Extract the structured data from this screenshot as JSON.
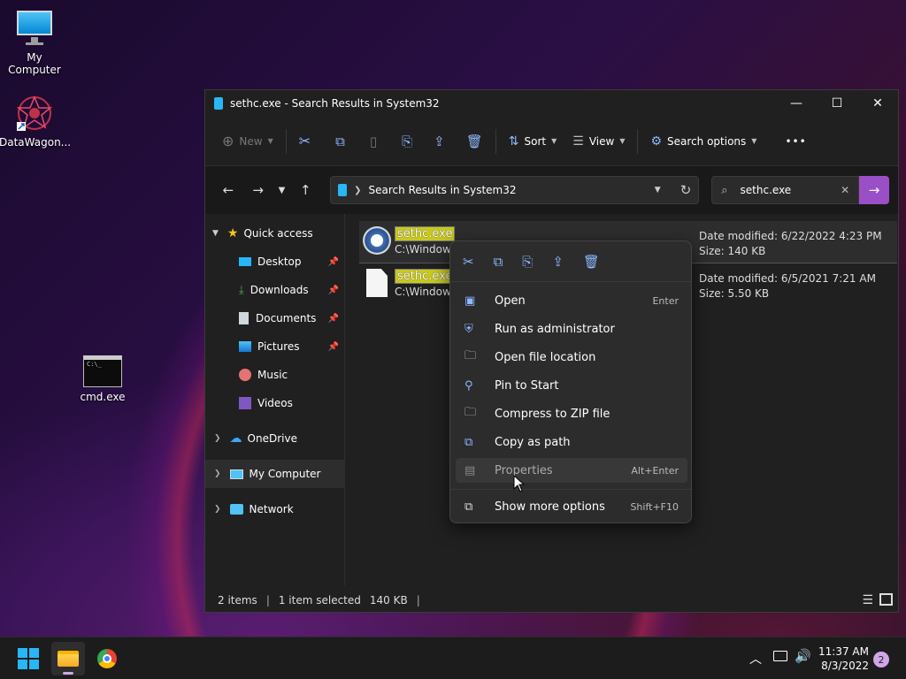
{
  "desktop": {
    "icons": [
      {
        "label": "My Computer"
      },
      {
        "label": "DataWagon..."
      },
      {
        "label": "cmd.exe"
      }
    ]
  },
  "window": {
    "title": "sethc.exe - Search Results in System32",
    "controls": {
      "minimize": "—",
      "maximize": "☐",
      "close": "✕"
    }
  },
  "toolbar": {
    "new_label": "New",
    "sort_label": "Sort",
    "view_label": "View",
    "search_options_label": "Search options",
    "more_label": "•••"
  },
  "address": {
    "path": "Search Results in System32",
    "search_value": "sethc.exe"
  },
  "nav": {
    "quick_access": "Quick access",
    "items": [
      {
        "label": "Desktop"
      },
      {
        "label": "Downloads"
      },
      {
        "label": "Documents"
      },
      {
        "label": "Pictures"
      },
      {
        "label": "Music"
      },
      {
        "label": "Videos"
      }
    ],
    "onedrive": "OneDrive",
    "my_computer": "My Computer",
    "network": "Network"
  },
  "files": [
    {
      "name": "sethc.exe",
      "path": "C:\\Window",
      "modified": "Date modified: 6/22/2022 4:23 PM",
      "size": "Size: 140 KB"
    },
    {
      "name": "sethc.exe",
      "path": "C:\\Window",
      "modified": "Date modified: 6/5/2021 7:21 AM",
      "size": "Size: 5.50 KB"
    }
  ],
  "context_menu": {
    "items": [
      {
        "label": "Open",
        "shortcut": "Enter"
      },
      {
        "label": "Run as administrator",
        "shortcut": ""
      },
      {
        "label": "Open file location",
        "shortcut": ""
      },
      {
        "label": "Pin to Start",
        "shortcut": ""
      },
      {
        "label": "Compress to ZIP file",
        "shortcut": ""
      },
      {
        "label": "Copy as path",
        "shortcut": ""
      },
      {
        "label": "Properties",
        "shortcut": "Alt+Enter"
      },
      {
        "label": "Show more options",
        "shortcut": "Shift+F10"
      }
    ]
  },
  "status": {
    "items_count": "2 items",
    "selected": "1 item selected",
    "selected_size": "140 KB"
  },
  "taskbar": {
    "time": "11:37 AM",
    "date": "8/3/2022",
    "notification_count": "2"
  }
}
